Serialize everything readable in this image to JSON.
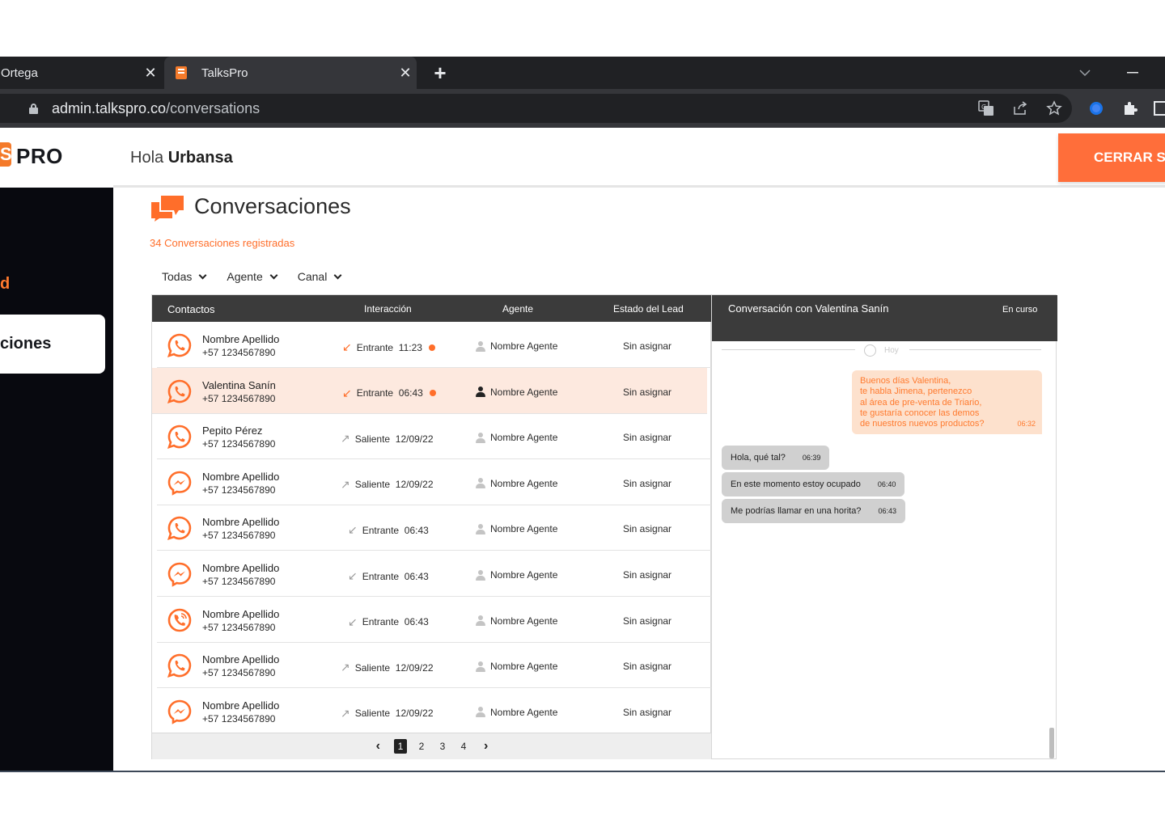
{
  "browser": {
    "tabs": [
      {
        "title": "Ortega",
        "active": false
      },
      {
        "title": "TalksPro",
        "active": true
      }
    ],
    "new_tab_glyph": "+",
    "close_glyph": "✕",
    "url_host": "admin.talkspro.co",
    "url_path": "/conversations"
  },
  "app": {
    "logo_mark": "S",
    "logo_text": "PRO",
    "greeting_prefix": "Hola ",
    "greeting_name": "Urbansa",
    "logout_label": "CERRAR SESIÓN",
    "brand_color": "#ff6e2a"
  },
  "sidebar": {
    "items": [
      {
        "label": "d",
        "state": "highlighted"
      },
      {
        "label": "ciones",
        "state": "active"
      }
    ]
  },
  "main": {
    "title": "Conversaciones",
    "count_text": "34 Conversaciones registradas",
    "filters": [
      {
        "label": "Todas"
      },
      {
        "label": "Agente"
      },
      {
        "label": "Canal"
      }
    ]
  },
  "table": {
    "headers": {
      "contacts": "Contactos",
      "interaction": "Interacción",
      "agent": "Agente",
      "lead_status": "Estado del Lead"
    },
    "rows": [
      {
        "channel": "whatsapp",
        "name": "Nombre Apellido",
        "phone": "+57 1234567890",
        "direction": "Entrante",
        "time": "11:23",
        "unread": true,
        "agent": "Nombre Agente",
        "status": "Sin asignar",
        "selected": false
      },
      {
        "channel": "whatsapp",
        "name": "Valentina Sanín",
        "phone": "+57 1234567890",
        "direction": "Entrante",
        "time": "06:43",
        "unread": true,
        "agent": "Nombre Agente",
        "status": "Sin asignar",
        "selected": true
      },
      {
        "channel": "whatsapp",
        "name": "Pepito Pérez",
        "phone": "+57 1234567890",
        "direction": "Saliente",
        "time": "12/09/22",
        "unread": false,
        "agent": "Nombre Agente",
        "status": "Sin asignar",
        "selected": false
      },
      {
        "channel": "messenger",
        "name": "Nombre Apellido",
        "phone": "+57 1234567890",
        "direction": "Saliente",
        "time": "12/09/22",
        "unread": false,
        "agent": "Nombre Agente",
        "status": "Sin asignar",
        "selected": false
      },
      {
        "channel": "whatsapp",
        "name": "Nombre Apellido",
        "phone": "+57 1234567890",
        "direction": "Entrante",
        "time": "06:43",
        "unread": false,
        "agent": "Nombre Agente",
        "status": "Sin asignar",
        "selected": false
      },
      {
        "channel": "messenger",
        "name": "Nombre Apellido",
        "phone": "+57 1234567890",
        "direction": "Entrante",
        "time": "06:43",
        "unread": false,
        "agent": "Nombre Agente",
        "status": "Sin asignar",
        "selected": false
      },
      {
        "channel": "phone",
        "name": "Nombre Apellido",
        "phone": "+57 1234567890",
        "direction": "Entrante",
        "time": "06:43",
        "unread": false,
        "agent": "Nombre Agente",
        "status": "Sin asignar",
        "selected": false
      },
      {
        "channel": "whatsapp",
        "name": "Nombre Apellido",
        "phone": "+57 1234567890",
        "direction": "Saliente",
        "time": "12/09/22",
        "unread": false,
        "agent": "Nombre Agente",
        "status": "Sin asignar",
        "selected": false
      },
      {
        "channel": "messenger",
        "name": "Nombre Apellido",
        "phone": "+57 1234567890",
        "direction": "Saliente",
        "time": "12/09/22",
        "unread": false,
        "agent": "Nombre Agente",
        "status": "Sin asignar",
        "selected": false
      }
    ],
    "pagination": {
      "pages": [
        "1",
        "2",
        "3",
        "4"
      ],
      "current": "1"
    }
  },
  "chat": {
    "title": "Conversación con Valentina Sanín",
    "status": "En curso",
    "day_label": "Hoy",
    "outgoing": {
      "text": "Buenos días Valentina,\nte habla Jimena, pertenezco\nal área de pre-venta de Triario,\nte gustaría conocer las demos\nde nuestros nuevos productos?",
      "time": "06:32"
    },
    "incoming": [
      {
        "text": "Hola, qué tal?",
        "time": "06:39"
      },
      {
        "text": "En este momento estoy ocupado",
        "time": "06:40"
      },
      {
        "text": "Me podrías llamar en una horita?",
        "time": "06:43"
      }
    ]
  }
}
